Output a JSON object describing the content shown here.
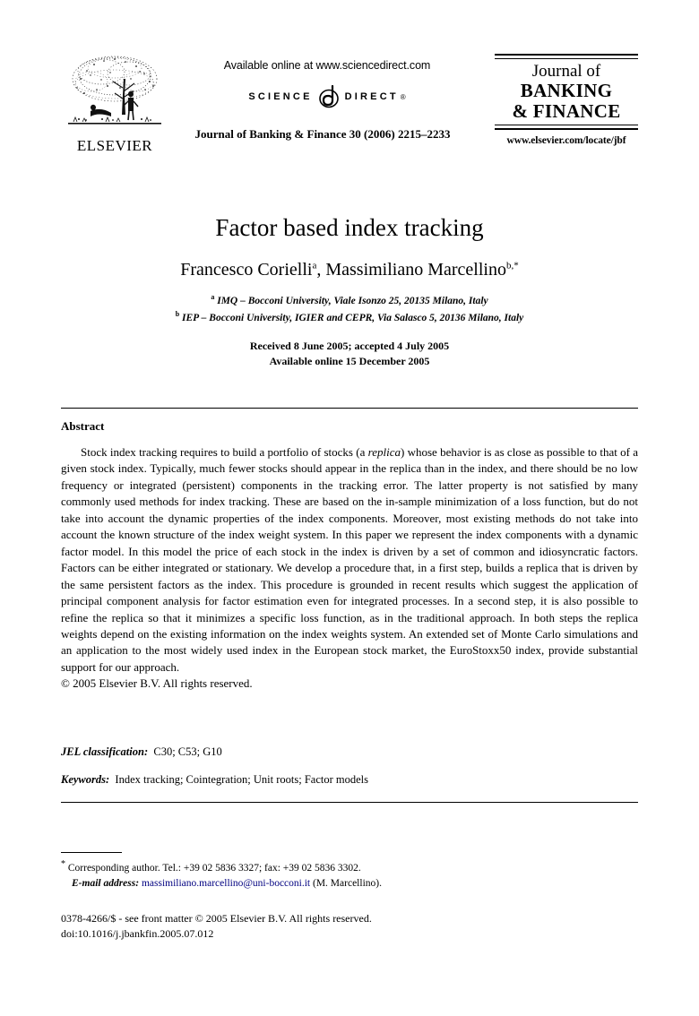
{
  "header": {
    "publisher_logo_name": "ELSEVIER",
    "available_online": "Available online at www.sciencedirect.com",
    "sciencedirect_left": "SCIENCE",
    "sciencedirect_right": "DIRECT",
    "sciencedirect_reg": "®",
    "journal_citation": "Journal of Banking & Finance 30 (2006) 2215–2233",
    "journal_logo_line1": "Journal of",
    "journal_logo_line2": "BANKING",
    "journal_logo_line3": "& FINANCE",
    "journal_url": "www.elsevier.com/locate/jbf"
  },
  "title_block": {
    "title": "Factor based index tracking",
    "authors": "Francesco Corielli",
    "author1_marker": "a",
    "authors_separator": ", Massimiliano Marcellino",
    "author2_marker": "b,*",
    "affiliation_a_marker": "a",
    "affiliation_a": "IMQ – Bocconi University, Viale Isonzo 25, 20135 Milano, Italy",
    "affiliation_b_marker": "b",
    "affiliation_b": "IEP – Bocconi University, IGIER and CEPR, Via Salasco 5, 20136 Milano, Italy",
    "received_line": "Received 8 June 2005; accepted 4 July 2005",
    "available_line": "Available online 15 December 2005"
  },
  "abstract": {
    "heading": "Abstract",
    "paragraph_part1": "Stock index tracking requires to build a portfolio of stocks (a ",
    "replica_italic": "replica",
    "paragraph_part2": ") whose behavior is as close as possible to that of a given stock index. Typically, much fewer stocks should appear in the replica than in the index, and there should be no low frequency or integrated (persistent) components in the tracking error. The latter property is not satisfied by many commonly used methods for index tracking. These are based on the in-sample minimization of a loss function, but do not take into account the dynamic properties of the index components. Moreover, most existing methods do not take into account the known structure of the index weight system. In this paper we represent the index components with a dynamic factor model. In this model the price of each stock in the index is driven by a set of common and idiosyncratic factors. Factors can be either integrated or stationary. We develop a procedure that, in a first step, builds a replica that is driven by the same persistent factors as the index. This procedure is grounded in recent results which suggest the application of principal component analysis for factor estimation even for integrated processes. In a second step, it is also possible to refine the replica so that it minimizes a specific loss function, as in the traditional approach. In both steps the replica weights depend on the existing information on the index weights system. An extended set of Monte Carlo simulations and an application to the most widely used index in the European stock market, the EuroStoxx50 index, provide substantial support for our approach.",
    "copyright": "© 2005 Elsevier B.V. All rights reserved."
  },
  "classification": {
    "jel_label": "JEL classification:",
    "jel_value": "C30; C53; G10",
    "keywords_label": "Keywords:",
    "keywords_value": "Index tracking; Cointegration; Unit roots; Factor models"
  },
  "footnote": {
    "marker": "*",
    "corresponding": "Corresponding author. Tel.: +39 02 5836 3327; fax: +39 02 5836 3302.",
    "email_label": "E-mail address:",
    "email": "massimiliano.marcellino@uni-bocconi.it",
    "email_suffix": "(M. Marcellino).",
    "email_color": "#000080"
  },
  "footer": {
    "issn_line": "0378-4266/$ - see front matter © 2005 Elsevier B.V. All rights reserved.",
    "doi_line": "doi:10.1016/j.jbankfin.2005.07.012"
  }
}
